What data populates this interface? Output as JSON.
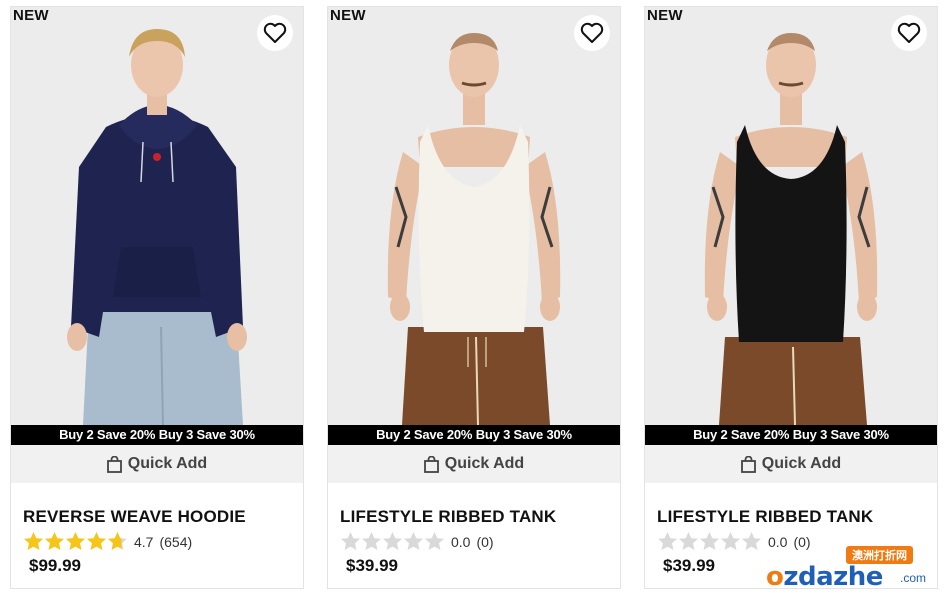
{
  "products": [
    {
      "badge": "NEW",
      "title": "REVERSE WEAVE HOODIE",
      "rating_value": "4.7",
      "rating_count": "(654)",
      "rating_fraction": 0.94,
      "price": "$99.99",
      "promo": "Buy 2 Save 20% Buy 3 Save 30%",
      "quick_add": "Quick Add",
      "top_color": "#1e2350",
      "pants_color": "#9db3c8"
    },
    {
      "badge": "NEW",
      "title": "LIFESTYLE RIBBED TANK",
      "rating_value": "0.0",
      "rating_count": "(0)",
      "rating_fraction": 0,
      "price": "$39.99",
      "promo": "Buy 2 Save 20% Buy 3 Save 30%",
      "quick_add": "Quick Add",
      "top_color": "#f4f2ea",
      "pants_color": "#7a4a2b"
    },
    {
      "badge": "NEW",
      "title": "LIFESTYLE RIBBED TANK",
      "rating_value": "0.0",
      "rating_count": "(0)",
      "rating_fraction": 0,
      "price": "$39.99",
      "promo": "Buy 2 Save 20% Buy 3 Save 30%",
      "quick_add": "Quick Add",
      "top_color": "#141414",
      "pants_color": "#7a4a2b"
    }
  ],
  "watermark": {
    "top_label": "澳洲打折网",
    "logo_main": "zdazhe",
    "logo_o": "o",
    "logo_suffix": ".com"
  },
  "colors": {
    "star_filled": "#f5c518",
    "star_empty": "#d9d9d9"
  }
}
